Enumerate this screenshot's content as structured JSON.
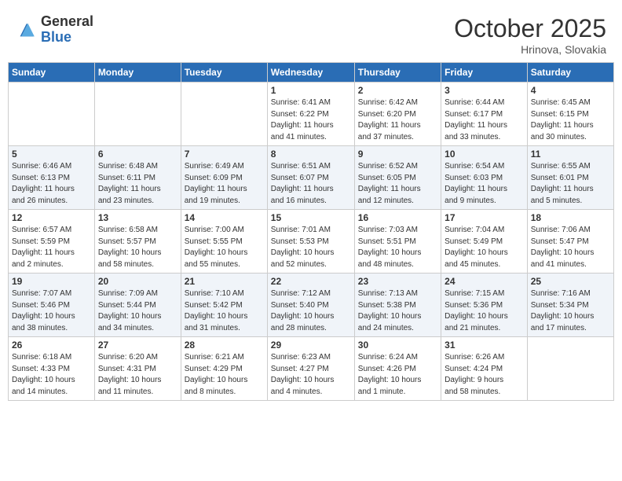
{
  "header": {
    "logo_general": "General",
    "logo_blue": "Blue",
    "month_title": "October 2025",
    "location": "Hrinova, Slovakia"
  },
  "weekdays": [
    "Sunday",
    "Monday",
    "Tuesday",
    "Wednesday",
    "Thursday",
    "Friday",
    "Saturday"
  ],
  "weeks": [
    [
      {
        "day": "",
        "info": ""
      },
      {
        "day": "",
        "info": ""
      },
      {
        "day": "",
        "info": ""
      },
      {
        "day": "1",
        "info": "Sunrise: 6:41 AM\nSunset: 6:22 PM\nDaylight: 11 hours\nand 41 minutes."
      },
      {
        "day": "2",
        "info": "Sunrise: 6:42 AM\nSunset: 6:20 PM\nDaylight: 11 hours\nand 37 minutes."
      },
      {
        "day": "3",
        "info": "Sunrise: 6:44 AM\nSunset: 6:17 PM\nDaylight: 11 hours\nand 33 minutes."
      },
      {
        "day": "4",
        "info": "Sunrise: 6:45 AM\nSunset: 6:15 PM\nDaylight: 11 hours\nand 30 minutes."
      }
    ],
    [
      {
        "day": "5",
        "info": "Sunrise: 6:46 AM\nSunset: 6:13 PM\nDaylight: 11 hours\nand 26 minutes."
      },
      {
        "day": "6",
        "info": "Sunrise: 6:48 AM\nSunset: 6:11 PM\nDaylight: 11 hours\nand 23 minutes."
      },
      {
        "day": "7",
        "info": "Sunrise: 6:49 AM\nSunset: 6:09 PM\nDaylight: 11 hours\nand 19 minutes."
      },
      {
        "day": "8",
        "info": "Sunrise: 6:51 AM\nSunset: 6:07 PM\nDaylight: 11 hours\nand 16 minutes."
      },
      {
        "day": "9",
        "info": "Sunrise: 6:52 AM\nSunset: 6:05 PM\nDaylight: 11 hours\nand 12 minutes."
      },
      {
        "day": "10",
        "info": "Sunrise: 6:54 AM\nSunset: 6:03 PM\nDaylight: 11 hours\nand 9 minutes."
      },
      {
        "day": "11",
        "info": "Sunrise: 6:55 AM\nSunset: 6:01 PM\nDaylight: 11 hours\nand 5 minutes."
      }
    ],
    [
      {
        "day": "12",
        "info": "Sunrise: 6:57 AM\nSunset: 5:59 PM\nDaylight: 11 hours\nand 2 minutes."
      },
      {
        "day": "13",
        "info": "Sunrise: 6:58 AM\nSunset: 5:57 PM\nDaylight: 10 hours\nand 58 minutes."
      },
      {
        "day": "14",
        "info": "Sunrise: 7:00 AM\nSunset: 5:55 PM\nDaylight: 10 hours\nand 55 minutes."
      },
      {
        "day": "15",
        "info": "Sunrise: 7:01 AM\nSunset: 5:53 PM\nDaylight: 10 hours\nand 52 minutes."
      },
      {
        "day": "16",
        "info": "Sunrise: 7:03 AM\nSunset: 5:51 PM\nDaylight: 10 hours\nand 48 minutes."
      },
      {
        "day": "17",
        "info": "Sunrise: 7:04 AM\nSunset: 5:49 PM\nDaylight: 10 hours\nand 45 minutes."
      },
      {
        "day": "18",
        "info": "Sunrise: 7:06 AM\nSunset: 5:47 PM\nDaylight: 10 hours\nand 41 minutes."
      }
    ],
    [
      {
        "day": "19",
        "info": "Sunrise: 7:07 AM\nSunset: 5:46 PM\nDaylight: 10 hours\nand 38 minutes."
      },
      {
        "day": "20",
        "info": "Sunrise: 7:09 AM\nSunset: 5:44 PM\nDaylight: 10 hours\nand 34 minutes."
      },
      {
        "day": "21",
        "info": "Sunrise: 7:10 AM\nSunset: 5:42 PM\nDaylight: 10 hours\nand 31 minutes."
      },
      {
        "day": "22",
        "info": "Sunrise: 7:12 AM\nSunset: 5:40 PM\nDaylight: 10 hours\nand 28 minutes."
      },
      {
        "day": "23",
        "info": "Sunrise: 7:13 AM\nSunset: 5:38 PM\nDaylight: 10 hours\nand 24 minutes."
      },
      {
        "day": "24",
        "info": "Sunrise: 7:15 AM\nSunset: 5:36 PM\nDaylight: 10 hours\nand 21 minutes."
      },
      {
        "day": "25",
        "info": "Sunrise: 7:16 AM\nSunset: 5:34 PM\nDaylight: 10 hours\nand 17 minutes."
      }
    ],
    [
      {
        "day": "26",
        "info": "Sunrise: 6:18 AM\nSunset: 4:33 PM\nDaylight: 10 hours\nand 14 minutes."
      },
      {
        "day": "27",
        "info": "Sunrise: 6:20 AM\nSunset: 4:31 PM\nDaylight: 10 hours\nand 11 minutes."
      },
      {
        "day": "28",
        "info": "Sunrise: 6:21 AM\nSunset: 4:29 PM\nDaylight: 10 hours\nand 8 minutes."
      },
      {
        "day": "29",
        "info": "Sunrise: 6:23 AM\nSunset: 4:27 PM\nDaylight: 10 hours\nand 4 minutes."
      },
      {
        "day": "30",
        "info": "Sunrise: 6:24 AM\nSunset: 4:26 PM\nDaylight: 10 hours\nand 1 minute."
      },
      {
        "day": "31",
        "info": "Sunrise: 6:26 AM\nSunset: 4:24 PM\nDaylight: 9 hours\nand 58 minutes."
      },
      {
        "day": "",
        "info": ""
      }
    ]
  ]
}
